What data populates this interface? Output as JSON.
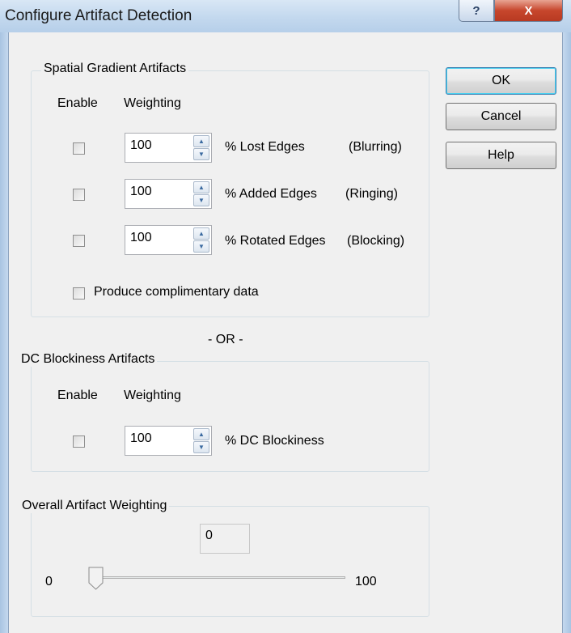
{
  "window": {
    "title": "Configure Artifact Detection"
  },
  "titlebar": {
    "help_icon": "?",
    "close_icon": "X"
  },
  "buttons": {
    "ok": "OK",
    "cancel": "Cancel",
    "help": "Help"
  },
  "spatial": {
    "title": "Spatial Gradient Artifacts",
    "header_enable": "Enable",
    "header_weighting": "Weighting",
    "rows": [
      {
        "value": "100",
        "label": "% Lost Edges",
        "type": "(Blurring)",
        "enabled": false
      },
      {
        "value": "100",
        "label": "% Added Edges",
        "type": "(Ringing)",
        "enabled": false
      },
      {
        "value": "100",
        "label": "% Rotated Edges",
        "type": "(Blocking)",
        "enabled": false
      }
    ],
    "complimentary": "Produce complimentary data"
  },
  "or_label": "- OR -",
  "dc": {
    "title": "DC Blockiness Artifacts",
    "header_enable": "Enable",
    "header_weighting": "Weighting",
    "value": "100",
    "label": "% DC Blockiness",
    "enabled": false
  },
  "overall": {
    "title": "Overall Artifact Weighting",
    "value": "0",
    "min": "0",
    "max": "100",
    "slider_fraction": 0
  },
  "icons": {
    "spin_up": "▲",
    "spin_down": "▼"
  }
}
